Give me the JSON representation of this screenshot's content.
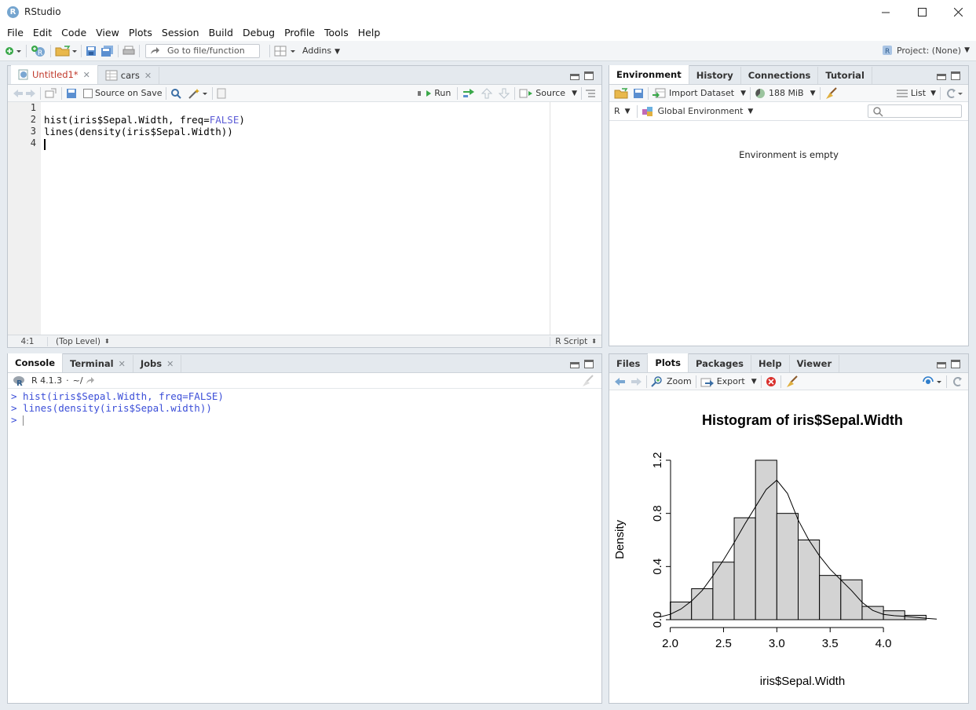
{
  "window": {
    "title": "RStudio",
    "app_icon": "R"
  },
  "menu": [
    "File",
    "Edit",
    "Code",
    "View",
    "Plots",
    "Session",
    "Build",
    "Debug",
    "Profile",
    "Tools",
    "Help"
  ],
  "toolbar": {
    "goto_placeholder": "Go to file/function",
    "addins": "Addins",
    "project": "Project: (None)"
  },
  "source": {
    "tabs": [
      {
        "label": "Untitled1*"
      },
      {
        "label": "cars"
      }
    ],
    "source_on_save": "Source on Save",
    "run": "Run",
    "source_btn": "Source",
    "line_numbers": [
      "1",
      "2",
      "3",
      "4"
    ],
    "lines": {
      "l2_pre": "hist(iris$Sepal.Width, freq=",
      "l2_kw": "FALSE",
      "l2_post": ")",
      "l3": "lines(density(iris$Sepal.Width))"
    },
    "status": {
      "position": "4:1",
      "scope": "(Top Level)",
      "filetype": "R Script"
    }
  },
  "console": {
    "tabs": [
      {
        "label": "Console"
      },
      {
        "label": "Terminal"
      },
      {
        "label": "Jobs"
      }
    ],
    "version": "R 4.1.3",
    "path": "~/",
    "lines": [
      "> hist(iris$Sepal.Width, freq=FALSE)",
      "> lines(density(iris$Sepal.width))",
      "> "
    ]
  },
  "environment": {
    "tabs": [
      {
        "label": "Environment"
      },
      {
        "label": "History"
      },
      {
        "label": "Connections"
      },
      {
        "label": "Tutorial"
      }
    ],
    "import": "Import Dataset",
    "memory": "188 MiB",
    "view": "List",
    "lang": "R",
    "scope": "Global Environment",
    "empty_message": "Environment is empty"
  },
  "files": {
    "tabs": [
      {
        "label": "Files"
      },
      {
        "label": "Plots"
      },
      {
        "label": "Packages"
      },
      {
        "label": "Help"
      },
      {
        "label": "Viewer"
      }
    ],
    "zoom": "Zoom",
    "export": "Export"
  },
  "chart_data": {
    "type": "bar",
    "title": "Histogram of iris$Sepal.Width",
    "xlabel": "iris$Sepal.Width",
    "ylabel": "Density",
    "bins": [
      [
        2.0,
        2.2,
        0.133
      ],
      [
        2.2,
        2.4,
        0.233
      ],
      [
        2.4,
        2.6,
        0.433
      ],
      [
        2.6,
        2.8,
        0.767
      ],
      [
        2.8,
        3.0,
        1.2
      ],
      [
        3.0,
        3.2,
        0.8
      ],
      [
        3.2,
        3.4,
        0.6
      ],
      [
        3.4,
        3.6,
        0.333
      ],
      [
        3.6,
        3.8,
        0.3
      ],
      [
        3.8,
        4.0,
        0.1
      ],
      [
        4.0,
        4.2,
        0.067
      ],
      [
        4.2,
        4.4,
        0.033
      ]
    ],
    "density_curve": [
      [
        1.9,
        0.02
      ],
      [
        2.0,
        0.04
      ],
      [
        2.1,
        0.08
      ],
      [
        2.2,
        0.14
      ],
      [
        2.3,
        0.22
      ],
      [
        2.4,
        0.33
      ],
      [
        2.5,
        0.45
      ],
      [
        2.6,
        0.58
      ],
      [
        2.7,
        0.72
      ],
      [
        2.8,
        0.85
      ],
      [
        2.9,
        0.98
      ],
      [
        3.0,
        1.05
      ],
      [
        3.1,
        0.95
      ],
      [
        3.2,
        0.75
      ],
      [
        3.3,
        0.6
      ],
      [
        3.4,
        0.48
      ],
      [
        3.5,
        0.38
      ],
      [
        3.6,
        0.3
      ],
      [
        3.7,
        0.22
      ],
      [
        3.8,
        0.13
      ],
      [
        3.9,
        0.07
      ],
      [
        4.0,
        0.04
      ],
      [
        4.1,
        0.03
      ],
      [
        4.2,
        0.025
      ],
      [
        4.3,
        0.018
      ],
      [
        4.4,
        0.01
      ],
      [
        4.5,
        0.005
      ]
    ],
    "xticks": [
      "2.0",
      "2.5",
      "3.0",
      "3.5",
      "4.0"
    ],
    "yticks": [
      "0.0",
      "0.4",
      "0.8",
      "1.2"
    ],
    "xlim": [
      1.9,
      4.5
    ],
    "ylim": [
      0,
      1.2
    ]
  }
}
